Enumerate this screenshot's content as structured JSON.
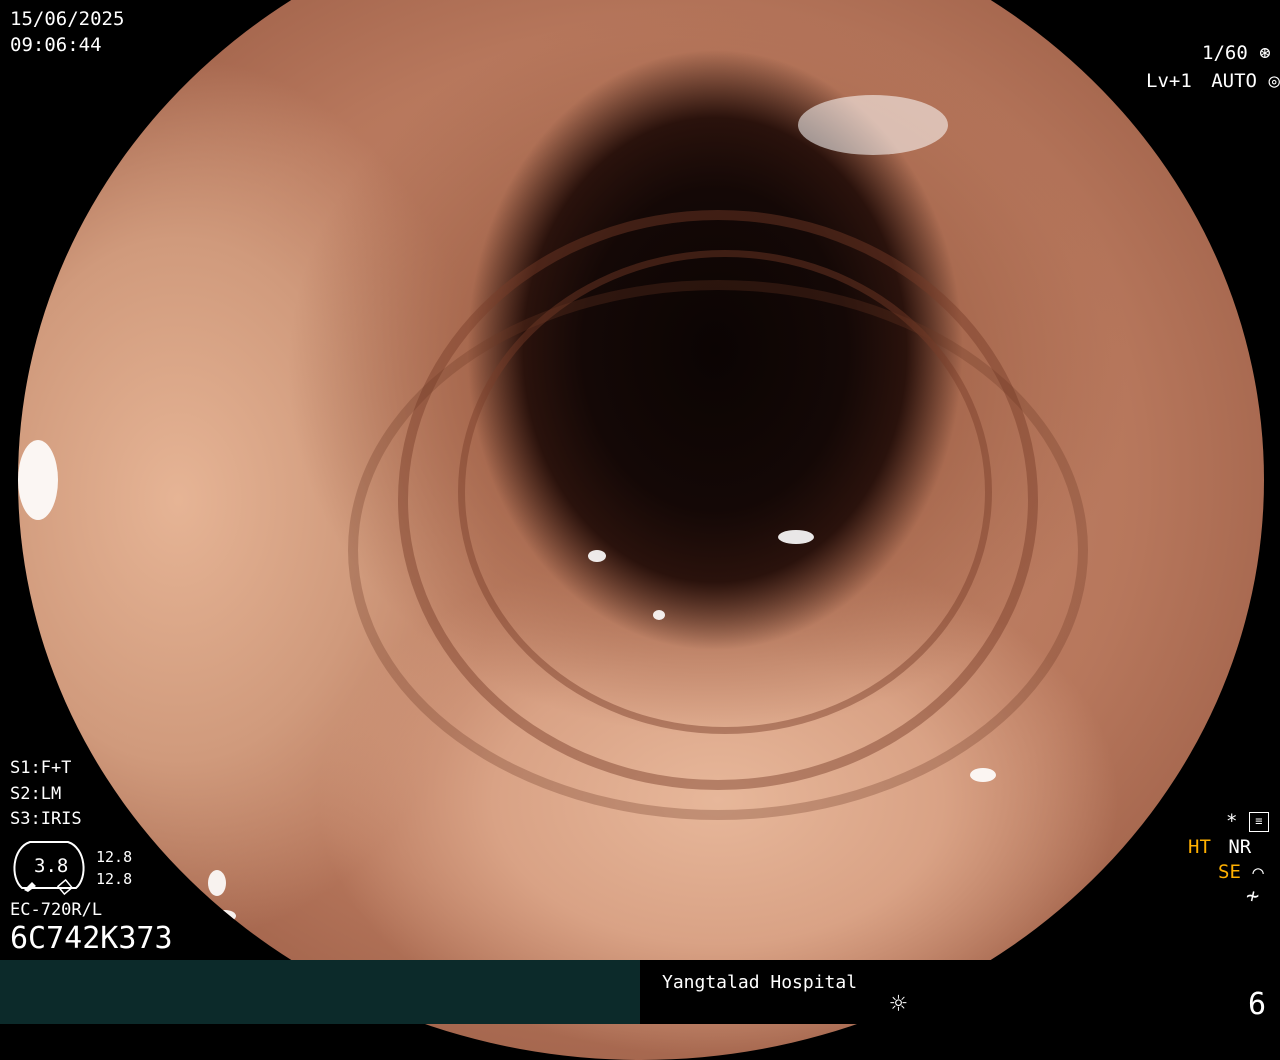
{
  "overlay": {
    "date": "15/06/2025",
    "time": "09:06:44",
    "shutter": "1/60",
    "shutter_icon": "aperture-icon",
    "level": "Lv+1",
    "auto": "AUTO",
    "auto_icon": "iris-icon",
    "s1": "S1:F+T",
    "s2": "S2:LM",
    "s3": "S3:IRIS",
    "gauge_value": "3.8",
    "gauge_top": "12.8",
    "gauge_bottom": "12.8",
    "scope_model": "EC-720R/L",
    "serial": "6C742K373",
    "asterisk": "*",
    "ht": "HT",
    "nr": "NR",
    "se": "SE",
    "right_icon_2": "squiggle-icon",
    "right_icon_3": "flash-off-icon",
    "hospital": "Yangtalad Hospital",
    "sun_icon": "sun-icon",
    "image_number": "6"
  },
  "colors": {
    "accent_yellow": "#ffb000",
    "bar_left": "#0c2a2a"
  }
}
